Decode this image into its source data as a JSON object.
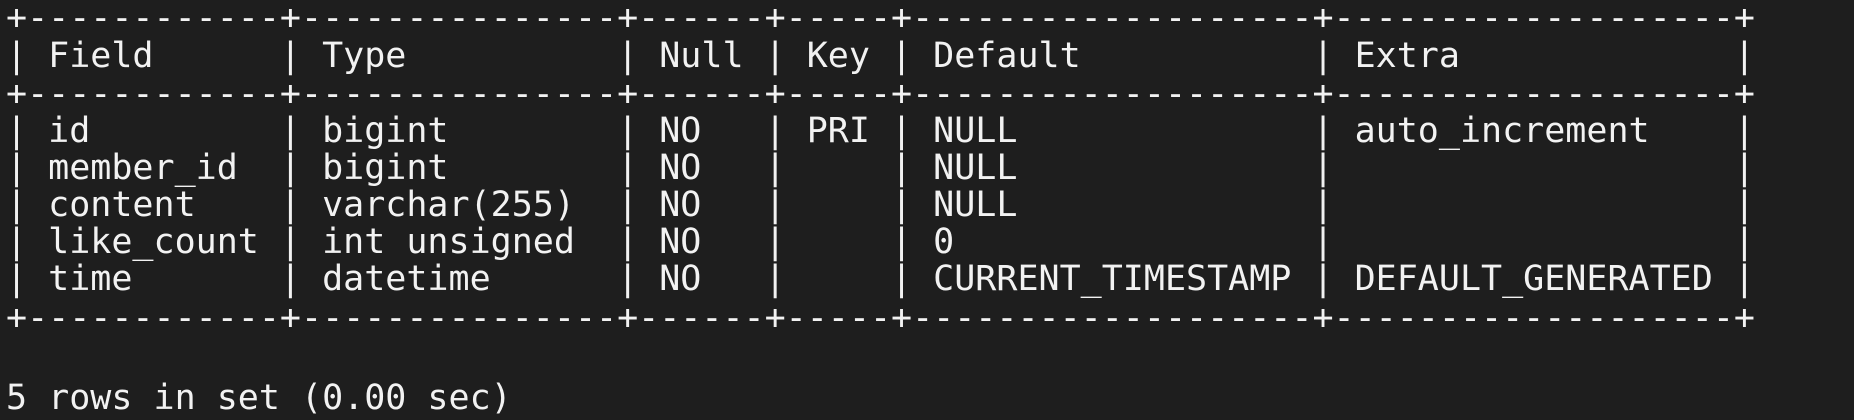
{
  "terminal": {
    "lines": [
      "+------------+---------------+------+-----+-------------------+-------------------+",
      "| Field      | Type          | Null | Key | Default           | Extra             |",
      "+------------+---------------+------+-----+-------------------+-------------------+",
      "| id         | bigint        | NO   | PRI | NULL              | auto_increment    |",
      "| member_id  | bigint        | NO   |     | NULL              |                   |",
      "| content    | varchar(255)  | NO   |     | NULL              |                   |",
      "| like_count | int unsigned  | NO   |     | 0                 |                   |",
      "| time       | datetime      | NO   |     | CURRENT_TIMESTAMP | DEFAULT_GENERATED |",
      "+------------+---------------+------+-----+-------------------+-------------------+",
      "5 rows in set (0.00 sec)"
    ]
  }
}
